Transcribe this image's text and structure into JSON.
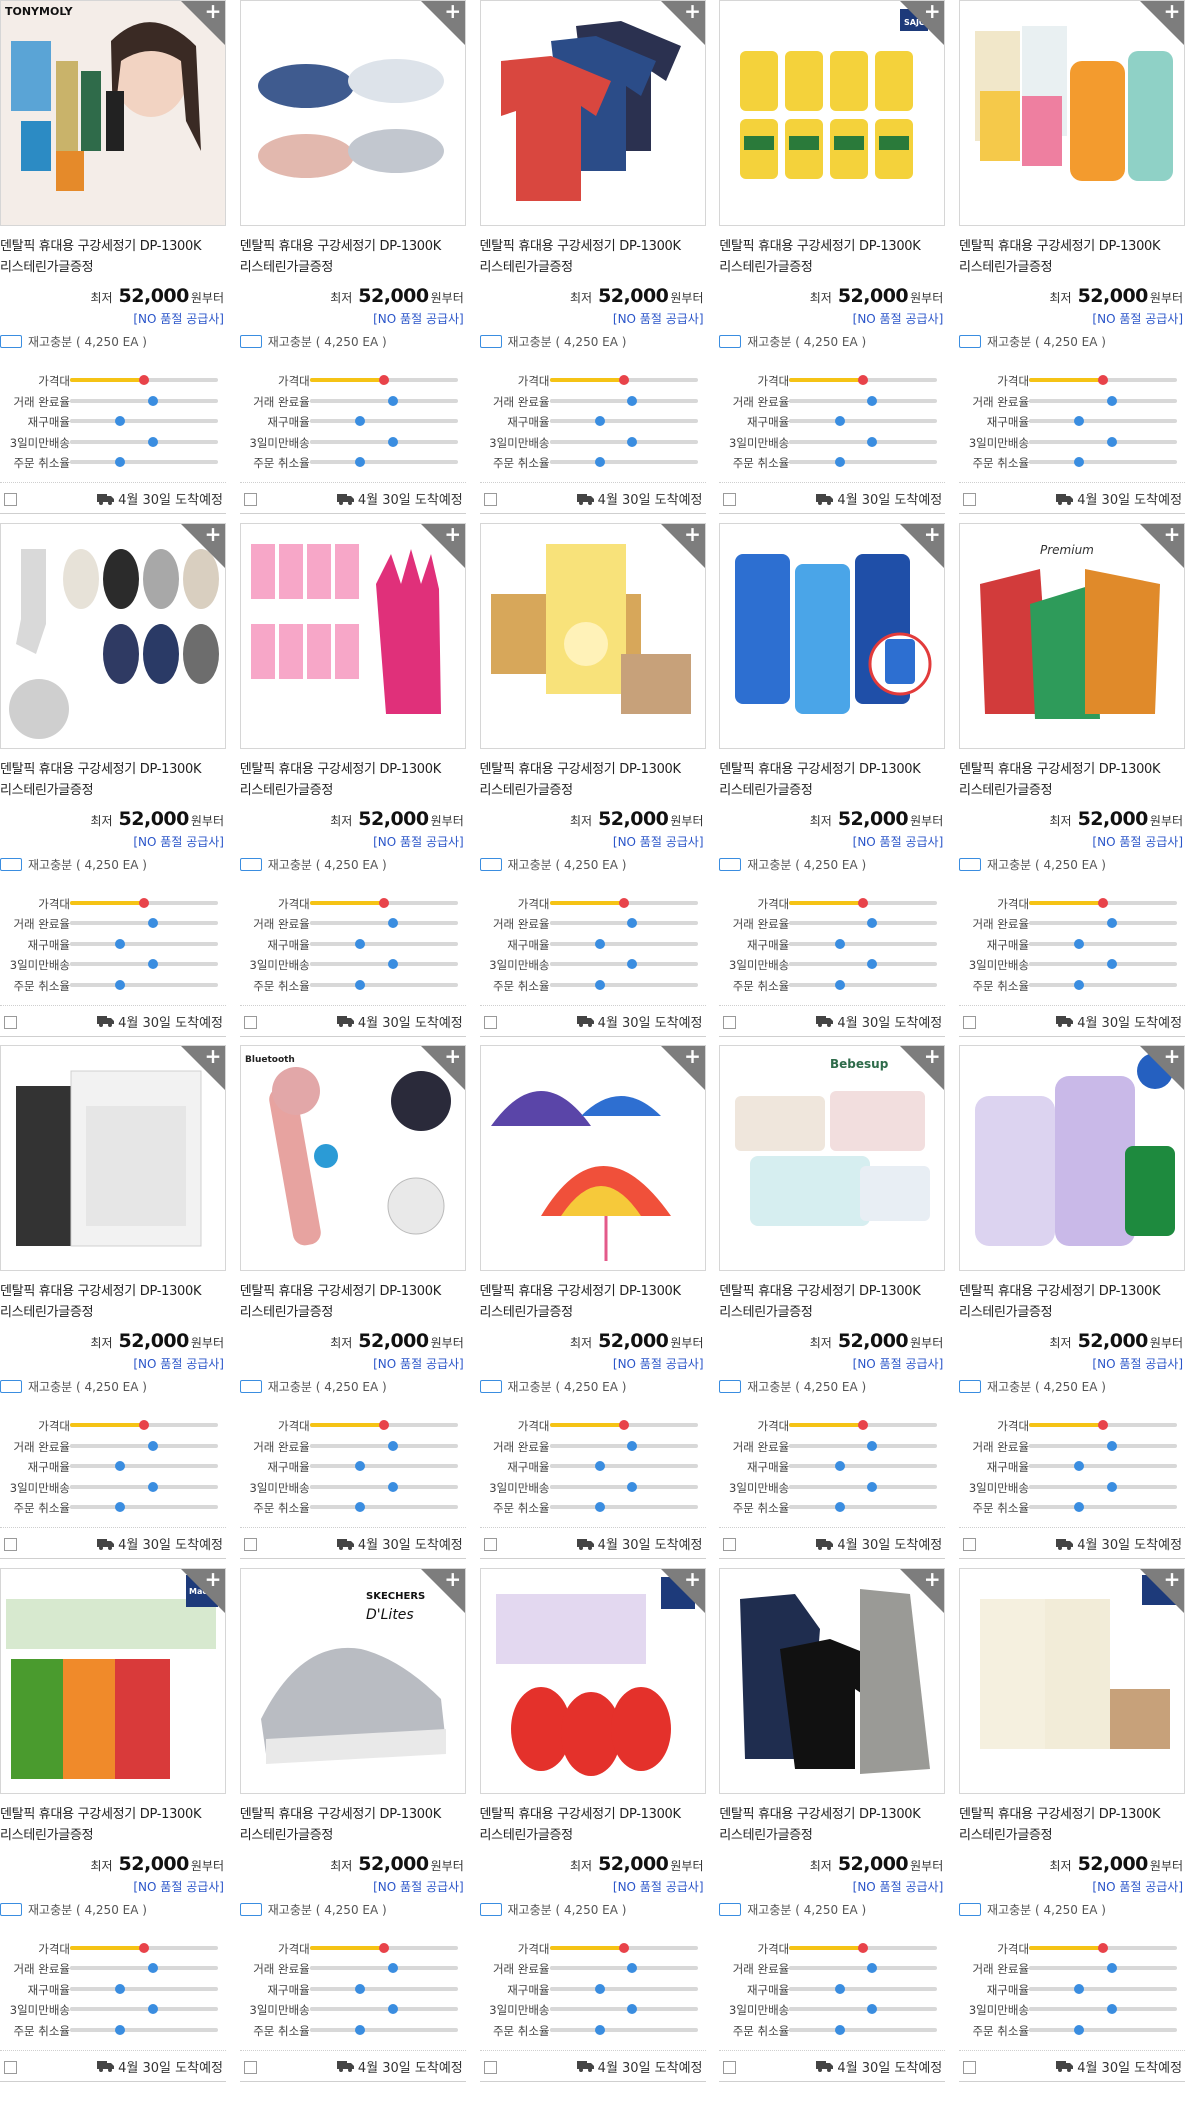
{
  "labels": {
    "plus": "+",
    "price_label": "최저",
    "price_suffix": "원부터",
    "supplier": "[NO 품절 공급사]",
    "stock": "재고충분 ( 4,250 EA )",
    "shipping": "4월 30일 도착예정"
  },
  "metric_labels": [
    "가격대",
    "거래 완료율",
    "재구매율",
    "3일미만배송",
    "주문 취소율"
  ],
  "metric_values": [
    0.5,
    0.56,
    0.34,
    0.56,
    0.34
  ],
  "colors": {
    "price_band": "#f5c315",
    "price_dot": "#e8434a",
    "metric": "#3a8de0",
    "supplier": "#2a55c9"
  },
  "brand_marks": [
    "TONYMOLY",
    "SAJO",
    "Premium",
    "Bluetooth",
    "Bebesup",
    "Maeil",
    "SKECHERS",
    "D'Lites"
  ],
  "products": [
    {
      "image": "cosmetics-model",
      "title1": "덴탈픽 휴대용 구강세정기 DP-1300K",
      "title2": "리스테린가글증정",
      "price": "52,000"
    },
    {
      "image": "kids-shoes",
      "title1": "덴탈픽 휴대용 구강세정기 DP-1300K",
      "title2": "리스테린가글증정",
      "price": "52,000"
    },
    {
      "image": "sport-tshirts",
      "title1": "덴탈픽 휴대용 구강세정기 DP-1300K",
      "title2": "리스테린가글증정",
      "price": "52,000"
    },
    {
      "image": "cooking-oil",
      "title1": "덴탈픽 휴대용 구강세정기 DP-1300K",
      "title2": "리스테린가글증정",
      "price": "52,000"
    },
    {
      "image": "detergent-refills",
      "title1": "덴탈픽 휴대용 구강세정기 DP-1300K",
      "title2": "리스테린가글증정",
      "price": "52,000"
    },
    {
      "image": "socks",
      "title1": "덴탈픽 휴대용 구강세정기 DP-1300K",
      "title2": "리스테린가글증정",
      "price": "52,000"
    },
    {
      "image": "rubber-gloves",
      "title1": "덴탈픽 휴대용 구강세정기 DP-1300K",
      "title2": "리스테린가글증정",
      "price": "52,000"
    },
    {
      "image": "banana-milk",
      "title1": "덴탈픽 휴대용 구강세정기 DP-1300K",
      "title2": "리스테린가글증정",
      "price": "52,000"
    },
    {
      "image": "mouthwash",
      "title1": "덴탈픽 휴대용 구강세정기 DP-1300K",
      "title2": "리스테린가글증정",
      "price": "52,000"
    },
    {
      "image": "premium-pouches",
      "title1": "덴탈픽 휴대용 구강세정기 DP-1300K",
      "title2": "리스테린가글증정",
      "price": "52,000"
    },
    {
      "image": "air-purifier",
      "title1": "덴탈픽 휴대용 구강세정기 DP-1300K",
      "title2": "리스테린가글증정",
      "price": "52,000"
    },
    {
      "image": "karaoke-mic",
      "title1": "덴탈픽 휴대용 구강세정기 DP-1300K",
      "title2": "리스테린가글증정",
      "price": "52,000"
    },
    {
      "image": "umbrellas",
      "title1": "덴탈픽 휴대용 구강세정기 DP-1300K",
      "title2": "리스테린가글증정",
      "price": "52,000"
    },
    {
      "image": "wet-wipes",
      "title1": "덴탈픽 휴대용 구강세정기 DP-1300K",
      "title2": "리스테린가글증정",
      "price": "52,000"
    },
    {
      "image": "fabric-softener",
      "title1": "덴탈픽 휴대용 구강세정기 DP-1300K",
      "title2": "리스테린가글증정",
      "price": "52,000"
    },
    {
      "image": "juice-boxes",
      "title1": "덴탈픽 휴대용 구강세정기 DP-1300K",
      "title2": "리스테린가글증정",
      "price": "52,000"
    },
    {
      "image": "sneakers",
      "title1": "덴탈픽 휴대용 구강세정기 DP-1300K",
      "title2": "리스테린가글증정",
      "price": "52,000"
    },
    {
      "image": "kinder-joy",
      "title1": "덴탈픽 휴대용 구강세정기 DP-1300K",
      "title2": "리스테린가글증정",
      "price": "52,000"
    },
    {
      "image": "black-tshirts",
      "title1": "덴탈픽 휴대용 구강세정기 DP-1300K",
      "title2": "리스테린가글증정",
      "price": "52,000"
    },
    {
      "image": "organic-milk",
      "title1": "덴탈픽 휴대용 구강세정기 DP-1300K",
      "title2": "리스테린가글증정",
      "price": "52,000"
    }
  ]
}
